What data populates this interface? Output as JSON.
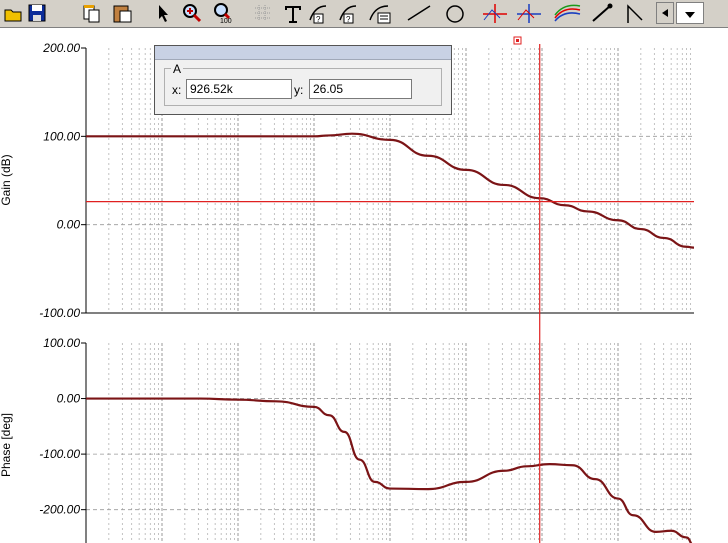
{
  "toolbar": {
    "icons": [
      "open-icon",
      "save-icon",
      "copy-icon",
      "paste-icon",
      "pointer-icon",
      "zoom-in-icon",
      "zoom-100-icon",
      "grid-icon",
      "text-icon",
      "cursor-a-icon",
      "cursor-b-icon",
      "cursor-list-icon",
      "line-icon",
      "circle-icon",
      "crosshair-red-icon",
      "crosshair-blue-icon",
      "curves-icon",
      "marker-icon",
      "arrow-icon",
      "scroll-left-icon",
      "dropdown-icon"
    ],
    "zoom_badge": "100"
  },
  "cursor_panel": {
    "group_label": "A",
    "x_label": "x:",
    "x_value": "926.52k",
    "y_label": "y:",
    "y_value": "26.05"
  },
  "colors": {
    "trace": "#7b1416",
    "cursor": "#e02020",
    "grid": "#9a9a9a"
  },
  "chart_data": [
    {
      "type": "line",
      "ylabel": "Gain (dB)",
      "ytick_labels": [
        "200.00",
        "100.00",
        "0.00",
        "-100.00"
      ],
      "ylim": [
        -100,
        200
      ],
      "x_scale": "log",
      "grid": true,
      "series": [
        {
          "x_decade_pos": [
            0,
            1,
            2,
            2.5,
            3,
            3.2,
            3.5,
            4,
            4.5,
            5,
            5.5,
            5.97,
            6.3,
            6.6,
            7,
            7.3,
            7.6,
            7.9,
            8
          ],
          "values": [
            100,
            100,
            100,
            100,
            100,
            101,
            103,
            96,
            78,
            62,
            45,
            30,
            22,
            15,
            5,
            -5,
            -15,
            -25,
            -26
          ]
        }
      ],
      "cursor": {
        "x_decade_pos": 5.97,
        "y": 26.05,
        "label": "A"
      }
    },
    {
      "type": "line",
      "ylabel": "Phase [deg]",
      "ytick_labels": [
        "100.00",
        "0.00",
        "-100.00",
        "-200.00"
      ],
      "ylim": [
        -260,
        100
      ],
      "x_scale": "log",
      "grid": true,
      "series": [
        {
          "x_decade_pos": [
            0,
            1,
            1.5,
            2,
            2.5,
            3,
            3.2,
            3.4,
            3.6,
            3.8,
            4,
            4.5,
            5,
            5.5,
            5.8,
            6.1,
            6.4,
            6.7,
            7,
            7.2,
            7.5,
            7.7,
            7.9,
            8
          ],
          "values": [
            0,
            0,
            0,
            -2,
            -5,
            -15,
            -30,
            -60,
            -110,
            -150,
            -162,
            -163,
            -150,
            -130,
            -122,
            -118,
            -120,
            -145,
            -180,
            -210,
            -240,
            -238,
            -250,
            -265
          ]
        }
      ],
      "cursor": {
        "x_decade_pos": 5.97
      }
    }
  ]
}
